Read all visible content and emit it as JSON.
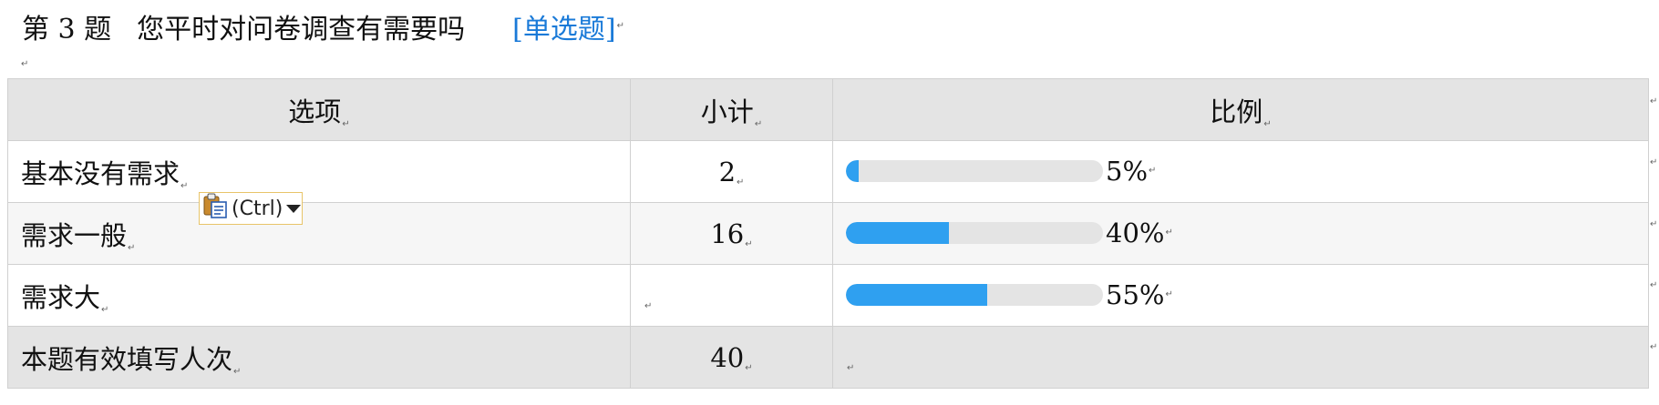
{
  "question": {
    "number": "第 3 题",
    "title": "您平时对问卷调查有需要吗",
    "type_open": "[",
    "type": "单选题",
    "type_close": "]"
  },
  "marks": {
    "para": "↵"
  },
  "table": {
    "headers": {
      "option": "选项",
      "count": "小计",
      "ratio": "比例"
    },
    "rows": [
      {
        "option": "基本没有需求",
        "count": "2",
        "percent_label": "5%",
        "percent": 5
      },
      {
        "option": "需求一般",
        "count": "16",
        "percent_label": "40%",
        "percent": 40
      },
      {
        "option": "需求大",
        "count": "",
        "percent_label": "55%",
        "percent": 55
      }
    ],
    "total": {
      "label": "本题有效填写人次",
      "count": "40"
    }
  },
  "paste_options": {
    "label": "(Ctrl)",
    "icon": "clipboard-icon"
  },
  "colors": {
    "accent_blue": "#1a7ad8",
    "bar_fill": "#2fa0f0",
    "bar_track": "#e4e4e4",
    "header_bg": "#e4e4e4",
    "paste_border": "#e8c469"
  }
}
